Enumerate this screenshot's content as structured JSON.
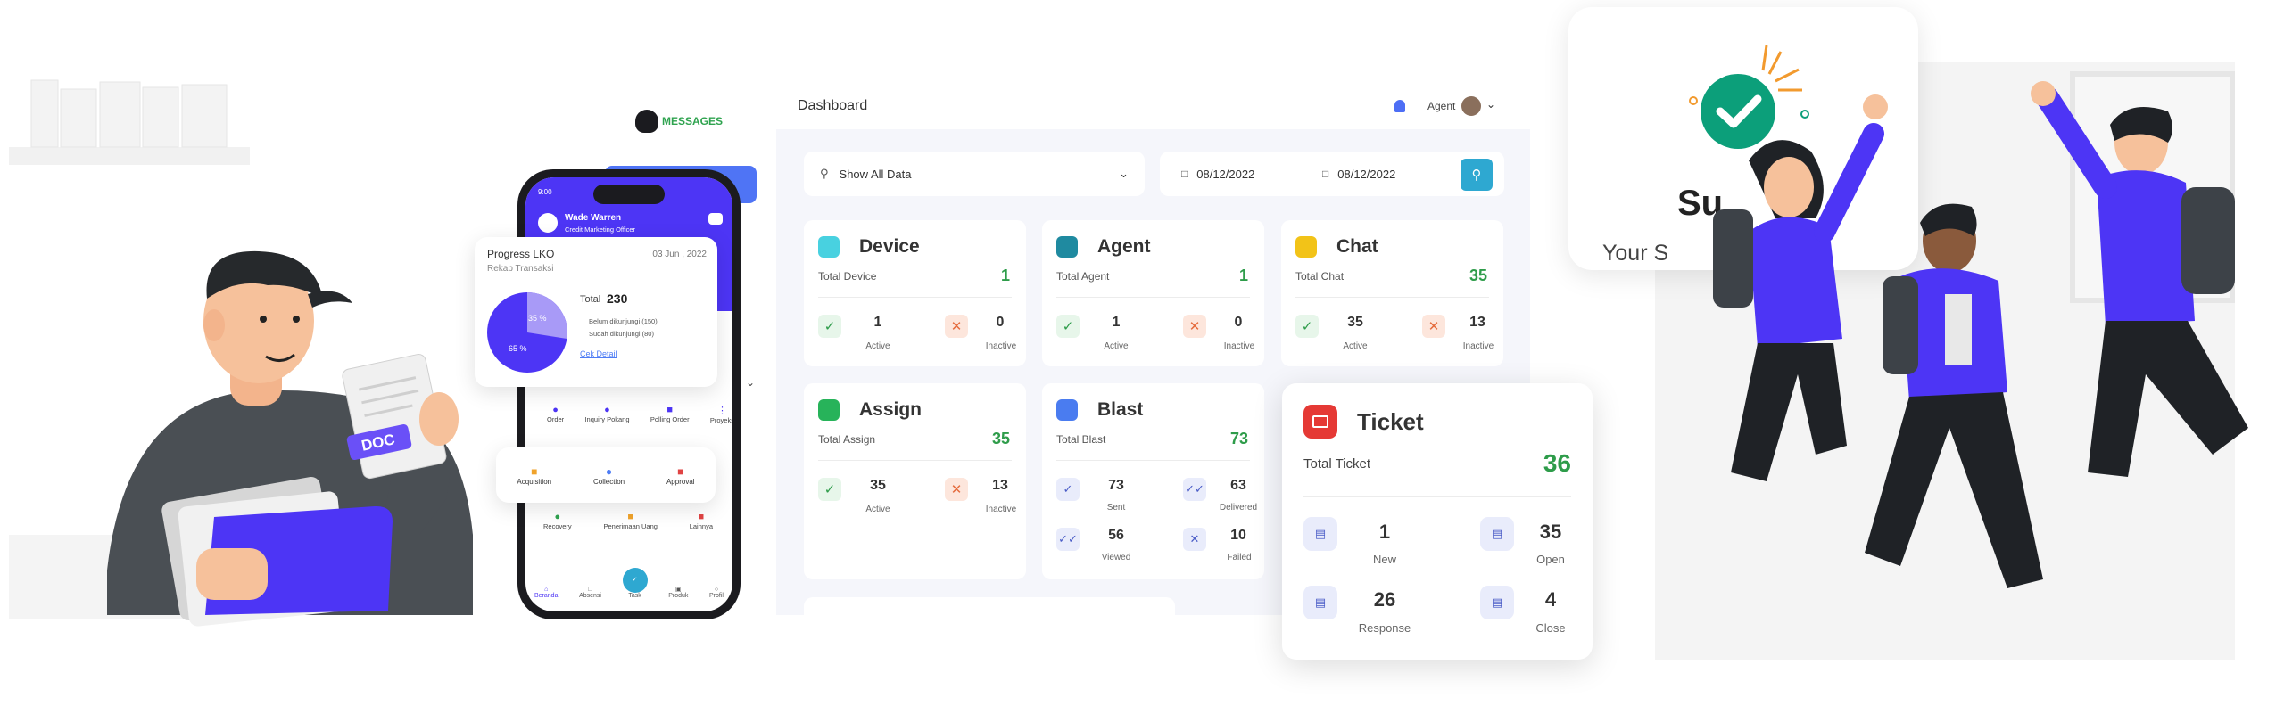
{
  "brand": {
    "name": "MESSAGES"
  },
  "dashboard": {
    "title": "Dashboard",
    "user_role": "Agent",
    "filter_select": "Show All Data",
    "date_from": "08/12/2022",
    "date_to": "08/12/2022"
  },
  "cards": {
    "device": {
      "title": "Device",
      "total_label": "Total Device",
      "total": "1",
      "a_val": "1",
      "a_lbl": "Active",
      "b_val": "0",
      "b_lbl": "Inactive"
    },
    "agent": {
      "title": "Agent",
      "total_label": "Total Agent",
      "total": "1",
      "a_val": "1",
      "a_lbl": "Active",
      "b_val": "0",
      "b_lbl": "Inactive"
    },
    "chat": {
      "title": "Chat",
      "total_label": "Total Chat",
      "total": "35",
      "a_val": "35",
      "a_lbl": "Active",
      "b_val": "13",
      "b_lbl": "Inactive"
    },
    "assign": {
      "title": "Assign",
      "total_label": "Total Assign",
      "total": "35",
      "a_val": "35",
      "a_lbl": "Active",
      "b_val": "13",
      "b_lbl": "Inactive"
    },
    "blast": {
      "title": "Blast",
      "total_label": "Total Blast",
      "total": "73",
      "sent": "73",
      "sent_lbl": "Sent",
      "delivered": "63",
      "delivered_lbl": "Delivered",
      "viewed": "56",
      "viewed_lbl": "Viewed",
      "failed": "10",
      "failed_lbl": "Failed"
    },
    "ticket": {
      "title": "Ticket",
      "total_label": "Total Ticket",
      "total": "36",
      "new": "1",
      "new_lbl": "New",
      "open": "35",
      "open_lbl": "Open",
      "response": "26",
      "response_lbl": "Response",
      "close": "4",
      "close_lbl": "Close"
    }
  },
  "phone": {
    "time": "9:00",
    "user_name": "Wade Warren",
    "user_role": "Credit Marketing Officer",
    "menu_row1": [
      "Order",
      "Inquiry Pokang",
      "Polling Order",
      "Proyeks"
    ],
    "menu_row2": [
      "Acquisition",
      "Collection",
      "Approval"
    ],
    "menu_row3": [
      "Recovery",
      "Penerimaan Uang",
      "Lainnya"
    ],
    "nav": [
      "Beranda",
      "Absensi",
      "Task",
      "Produk",
      "Profil"
    ]
  },
  "progress": {
    "title": "Progress LKO",
    "date": "03 Jun , 2022",
    "subtitle": "Rekap Transaksi",
    "total_label": "Total",
    "total": "230",
    "legend_a": "Belum dikunjungi (150)",
    "legend_b": "Sudah dikunjungi (80)",
    "slice_small": "35 %",
    "slice_big": "65 %",
    "link": "Cek Detail"
  },
  "doc_tag": "DOC",
  "success": {
    "partial_title": "Su",
    "message": "Your S          cessfully"
  },
  "colors": {
    "brand": "#4d35f5",
    "green": "#2e9c4a",
    "ticket_red": "#e53935",
    "search_btn": "#2ea8d1"
  }
}
